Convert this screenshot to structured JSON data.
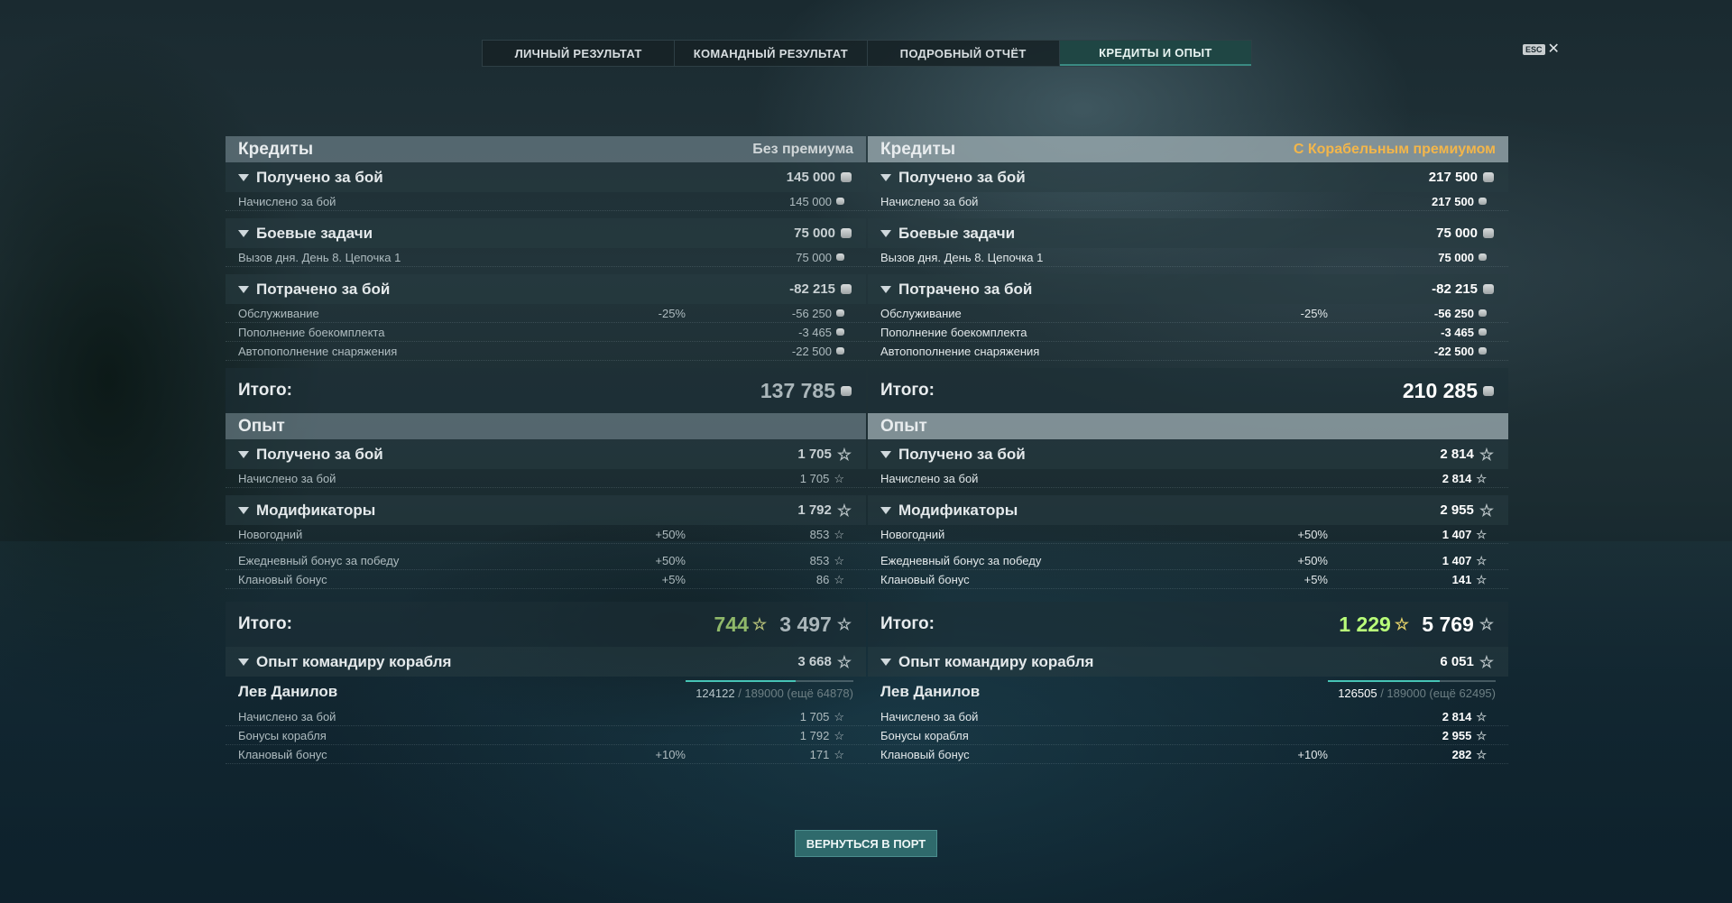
{
  "tabs": [
    "ЛИЧНЫЙ РЕЗУЛЬТАТ",
    "КОМАНДНЫЙ РЕЗУЛЬТАТ",
    "ПОДРОБНЫЙ ОТЧЁТ",
    "КРЕДИТЫ И ОПЫТ"
  ],
  "active_tab_index": 3,
  "esc": {
    "key": "ESC",
    "close": "✕"
  },
  "left": {
    "credits_title": "Кредиты",
    "credits_sub": "Без премиума",
    "earned": {
      "label": "Получено за бой",
      "value": "145 000",
      "rows": [
        {
          "label": "Начислено за бой",
          "pct": "",
          "value": "145 000"
        }
      ]
    },
    "tasks": {
      "label": "Боевые задачи",
      "value": "75 000",
      "rows": [
        {
          "label": "Вызов дня. День 8. Цепочка 1",
          "pct": "",
          "value": "75 000"
        }
      ]
    },
    "spent": {
      "label": "Потрачено за бой",
      "value": "-82 215",
      "rows": [
        {
          "label": "Обслуживание",
          "pct": "-25%",
          "value": "-56 250"
        },
        {
          "label": "Пополнение боекомплекта",
          "pct": "",
          "value": "-3 465"
        },
        {
          "label": "Автопополнение снаряжения",
          "pct": "",
          "value": "-22 500"
        }
      ]
    },
    "credits_total_label": "Итого:",
    "credits_total": "137 785",
    "xp_title": "Опыт",
    "xp_earned": {
      "label": "Получено за бой",
      "value": "1 705",
      "rows": [
        {
          "label": "Начислено за бой",
          "pct": "",
          "value": "1 705"
        }
      ]
    },
    "modifiers": {
      "label": "Модификаторы",
      "value": "1 792",
      "rows": [
        {
          "label": "Новогодний",
          "pct": "+50%",
          "value": "853"
        },
        {
          "label": "Ежедневный бонус за победу",
          "pct": "+50%",
          "value": "853"
        },
        {
          "label": "Клановый бонус",
          "pct": "+5%",
          "value": "86"
        }
      ]
    },
    "xp_total_label": "Итого:",
    "xp_free": "744",
    "xp_total": "3 497",
    "commander": {
      "label": "Опыт командиру корабля",
      "value": "3 668"
    },
    "captain": {
      "name": "Лев Данилов",
      "current": "124122",
      "rest": "/ 189000 (ещё 64878)",
      "progress": 0.657,
      "rows": [
        {
          "label": "Начислено за бой",
          "pct": "",
          "value": "1 705"
        },
        {
          "label": "Бонусы корабля",
          "pct": "",
          "value": "1 792"
        },
        {
          "label": "Клановый бонус",
          "pct": "+10%",
          "value": "171"
        }
      ]
    }
  },
  "right": {
    "credits_title": "Кредиты",
    "credits_sub": "С Корабельным премиумом",
    "earned": {
      "label": "Получено за бой",
      "value": "217 500",
      "rows": [
        {
          "label": "Начислено за бой",
          "pct": "",
          "value": "217 500"
        }
      ]
    },
    "tasks": {
      "label": "Боевые задачи",
      "value": "75 000",
      "rows": [
        {
          "label": "Вызов дня. День 8. Цепочка 1",
          "pct": "",
          "value": "75 000"
        }
      ]
    },
    "spent": {
      "label": "Потрачено за бой",
      "value": "-82 215",
      "rows": [
        {
          "label": "Обслуживание",
          "pct": "-25%",
          "value": "-56 250"
        },
        {
          "label": "Пополнение боекомплекта",
          "pct": "",
          "value": "-3 465"
        },
        {
          "label": "Автопополнение снаряжения",
          "pct": "",
          "value": "-22 500"
        }
      ]
    },
    "credits_total_label": "Итого:",
    "credits_total": "210 285",
    "xp_title": "Опыт",
    "xp_earned": {
      "label": "Получено за бой",
      "value": "2 814",
      "rows": [
        {
          "label": "Начислено за бой",
          "pct": "",
          "value": "2 814"
        }
      ]
    },
    "modifiers": {
      "label": "Модификаторы",
      "value": "2 955",
      "rows": [
        {
          "label": "Новогодний",
          "pct": "+50%",
          "value": "1 407"
        },
        {
          "label": "Ежедневный бонус за победу",
          "pct": "+50%",
          "value": "1 407"
        },
        {
          "label": "Клановый бонус",
          "pct": "+5%",
          "value": "141"
        }
      ]
    },
    "xp_total_label": "Итого:",
    "xp_free": "1 229",
    "xp_total": "5 769",
    "commander": {
      "label": "Опыт командиру корабля",
      "value": "6 051"
    },
    "captain": {
      "name": "Лев Данилов",
      "current": "126505",
      "rest": "/ 189000 (ещё 62495)",
      "progress": 0.669,
      "rows": [
        {
          "label": "Начислено за бой",
          "pct": "",
          "value": "2 814"
        },
        {
          "label": "Бонусы корабля",
          "pct": "",
          "value": "2 955"
        },
        {
          "label": "Клановый бонус",
          "pct": "+10%",
          "value": "282"
        }
      ]
    }
  },
  "return_button": "ВЕРНУТЬСЯ В ПОРТ",
  "colors": {
    "accent": "#2f6a6c",
    "premium": "#f3b64a",
    "free_xp": "#b9ff7a",
    "progress": "#46c4b6"
  }
}
